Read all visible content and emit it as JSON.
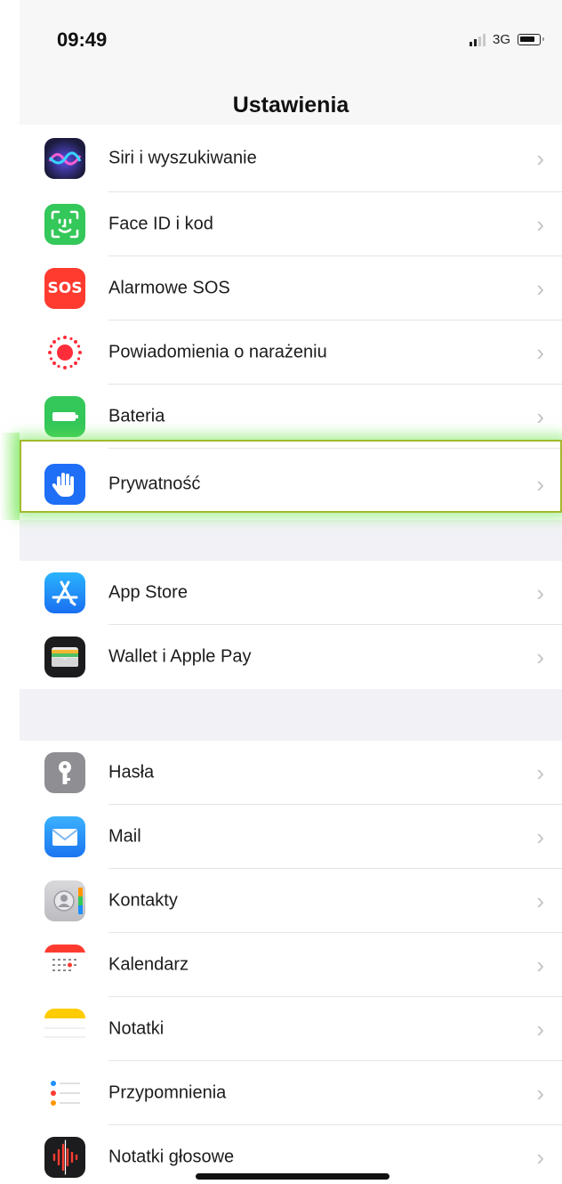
{
  "status_bar": {
    "time": "09:49",
    "network": "3G"
  },
  "nav": {
    "title": "Ustawienia"
  },
  "groups": [
    {
      "items": [
        {
          "label": "Siri i wyszukiwanie",
          "icon": "siri-icon",
          "color": "#1a1a3a"
        },
        {
          "label": "Face ID i kod",
          "icon": "face-id-icon",
          "color": "#34c759"
        },
        {
          "label": "Alarmowe SOS",
          "icon": "sos-icon",
          "color": "#ff3b30",
          "icon_text": "SOS"
        },
        {
          "label": "Powiadomienia o narażeniu",
          "icon": "exposure-notifications-icon",
          "color": "#ff3b30"
        },
        {
          "label": "Bateria",
          "icon": "battery-icon",
          "color": "#34c759"
        },
        {
          "label": "Prywatność",
          "icon": "hand-icon",
          "color": "#1e6ff5"
        }
      ]
    },
    {
      "items": [
        {
          "label": "App Store",
          "icon": "app-store-icon",
          "color": "#1e90ff"
        },
        {
          "label": "Wallet i Apple Pay",
          "icon": "wallet-icon",
          "color": "#1c1c1e"
        }
      ]
    },
    {
      "items": [
        {
          "label": "Hasła",
          "icon": "key-icon",
          "color": "#8e8e93"
        },
        {
          "label": "Mail",
          "icon": "mail-icon",
          "color": "#1e90ff"
        },
        {
          "label": "Kontakty",
          "icon": "contacts-icon",
          "color": "#c9c9cc"
        },
        {
          "label": "Kalendarz",
          "icon": "calendar-icon",
          "color": "#ffffff"
        },
        {
          "label": "Notatki",
          "icon": "notes-icon",
          "color": "#ffffff"
        },
        {
          "label": "Przypomnienia",
          "icon": "reminders-icon",
          "color": "#ffffff"
        },
        {
          "label": "Notatki głosowe",
          "icon": "voice-memos-icon",
          "color": "#1c1c1e"
        }
      ]
    }
  ],
  "highlighted_item": "Prywatność",
  "chevron": "›"
}
